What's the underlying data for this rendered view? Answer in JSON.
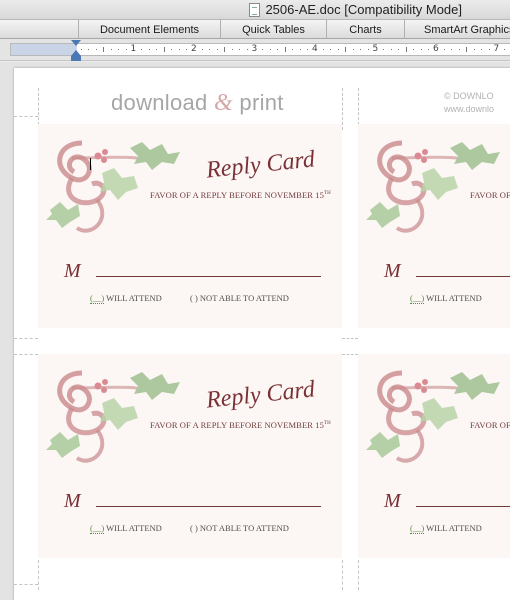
{
  "window": {
    "title": "2506-AE.doc [Compatibility Mode]"
  },
  "ribbon": {
    "tabs": [
      {
        "label": "Document Elements"
      },
      {
        "label": "Quick Tables"
      },
      {
        "label": "Charts"
      },
      {
        "label": "SmartArt Graphics"
      }
    ]
  },
  "ruler": {
    "numbers": [
      "1",
      "2",
      "3",
      "4",
      "5",
      "6",
      "7"
    ]
  },
  "document": {
    "brand_left": "download",
    "brand_amp": "&",
    "brand_right": "print",
    "copyright_line1": "© DOWNLO",
    "copyright_line2": "www.downlo",
    "card": {
      "title": "Reply Card",
      "subtitle": "FAVOR OF A REPLY BEFORE NOVEMBER 15",
      "subtitle_sup": "TH",
      "subtitle_partial": "FAVOR OF",
      "name_prefix": "M",
      "attend_box": "(__)",
      "attend_label": "WILL ATTEND",
      "decline_box": "(   )",
      "decline_label": "NOT ABLE TO ATTEND"
    }
  },
  "colors": {
    "card_text": "#7a3135",
    "holly_green": "#9fbf8e",
    "ribbon_pink": "#c9888b",
    "berry": "#d98a92"
  }
}
